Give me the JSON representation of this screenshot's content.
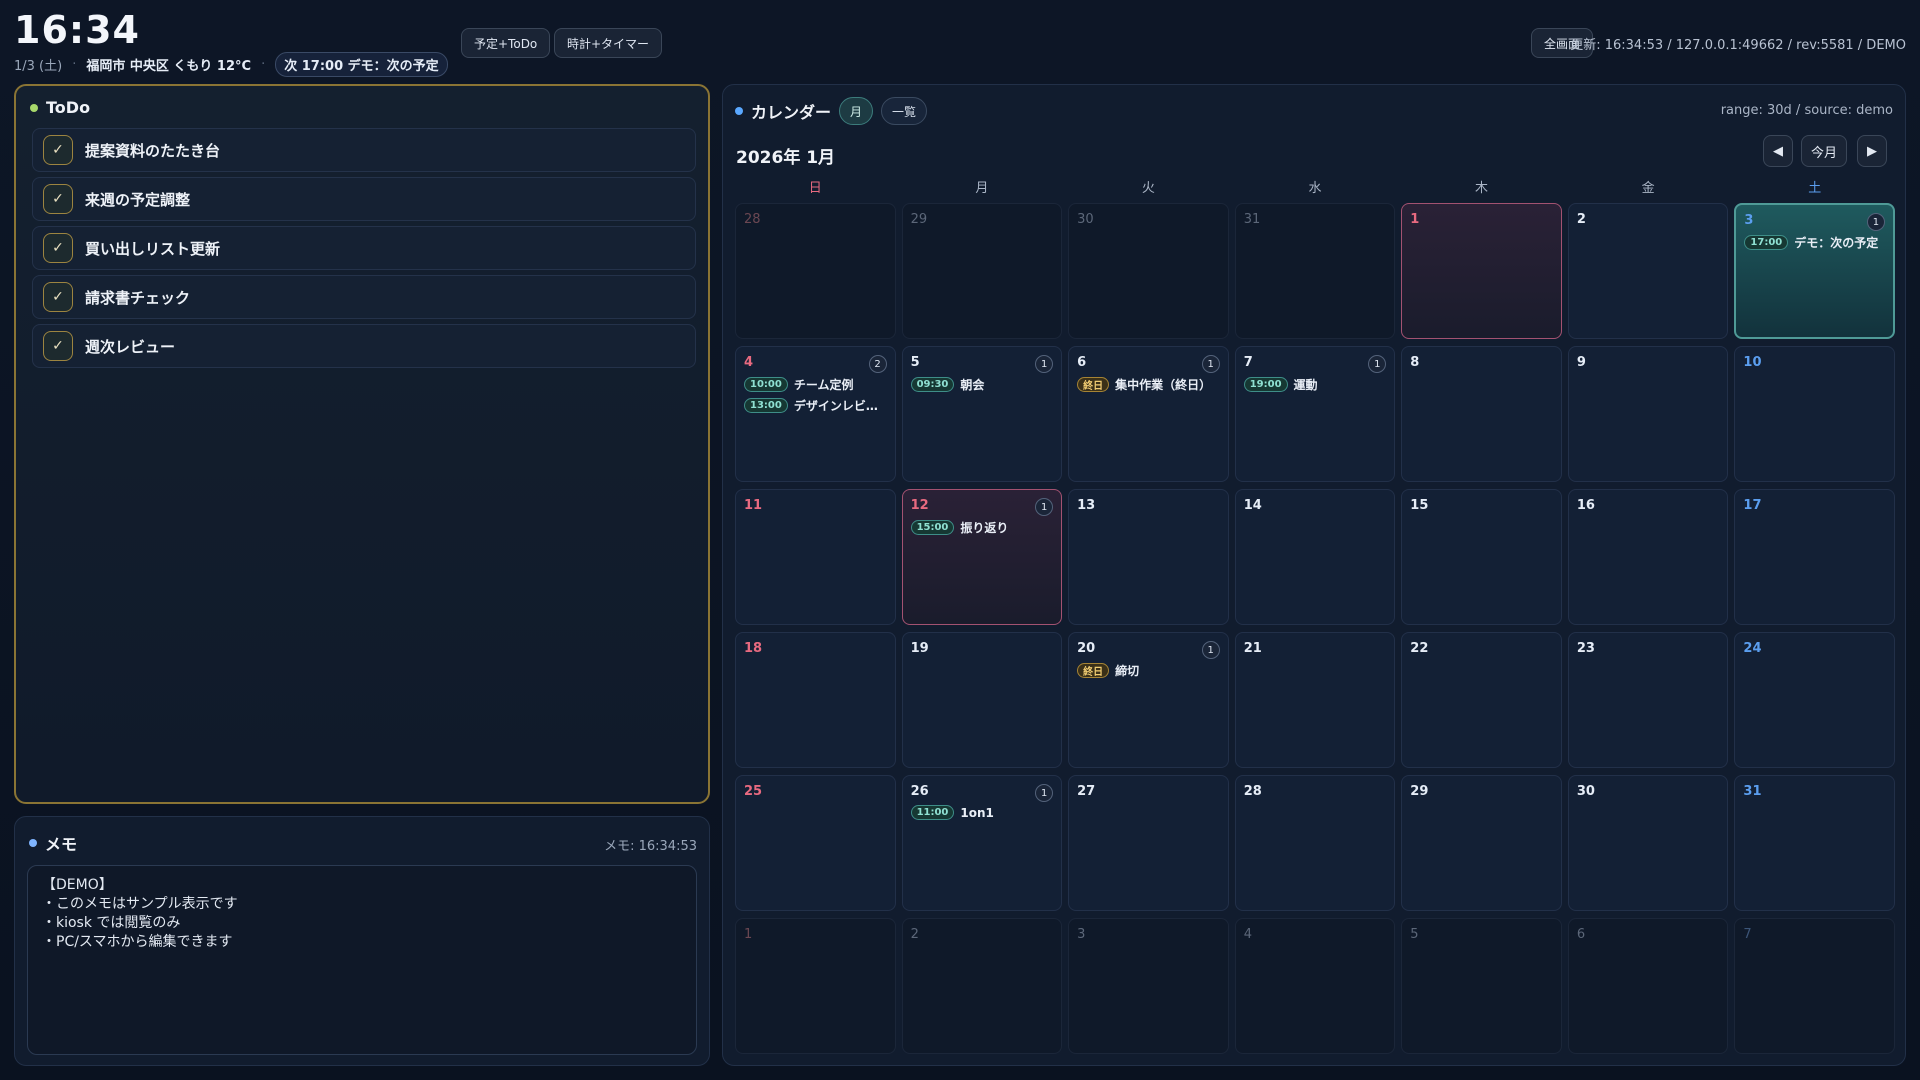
{
  "header": {
    "time": "16:34",
    "date": "1/3 (土)",
    "weather": "福岡市 中央区 くもり 12°C",
    "next": "次 17:00 デモ：次の予定",
    "btn_schedule": "予定+ToDo",
    "btn_clock": "時計+タイマー",
    "btn_fullscreen": "全画面",
    "status": "更新: 16:34:53 / 127.0.0.1:49662 / rev:5581 / DEMO"
  },
  "todo": {
    "title": "ToDo",
    "items": [
      {
        "label": "提案資料のたたき台"
      },
      {
        "label": "来週の予定調整"
      },
      {
        "label": "買い出しリスト更新"
      },
      {
        "label": "請求書チェック"
      },
      {
        "label": "週次レビュー"
      }
    ]
  },
  "memo": {
    "title": "メモ",
    "time": "メモ: 16:34:53",
    "lines": [
      "【DEMO】",
      "・このメモはサンプル表示です",
      "・kiosk では閲覧のみ",
      "・PC/スマホから編集できます"
    ]
  },
  "calendar": {
    "title": "カレンダー",
    "view_month": "月",
    "view_list": "一覧",
    "range": "range: 30d / source: demo",
    "month_label": "2026年 1月",
    "prev": "◀",
    "today": "今月",
    "next": "▶",
    "weekdays": [
      "日",
      "月",
      "火",
      "水",
      "木",
      "金",
      "土"
    ],
    "days": [
      {
        "n": "28",
        "other": true
      },
      {
        "n": "29",
        "other": true
      },
      {
        "n": "30",
        "other": true
      },
      {
        "n": "31",
        "other": true
      },
      {
        "n": "1",
        "holiday": true
      },
      {
        "n": "2"
      },
      {
        "n": "3",
        "today": true,
        "count": "1",
        "events": [
          {
            "time": "17:00",
            "title": "デモ：次の予定"
          }
        ]
      },
      {
        "n": "4",
        "count": "2",
        "events": [
          {
            "time": "10:00",
            "title": "チーム定例"
          },
          {
            "time": "13:00",
            "title": "デザインレビ…"
          }
        ]
      },
      {
        "n": "5",
        "count": "1",
        "events": [
          {
            "time": "09:30",
            "title": "朝会"
          }
        ]
      },
      {
        "n": "6",
        "count": "1",
        "events": [
          {
            "time": "終日",
            "allday": true,
            "title": "集中作業（終日）"
          }
        ]
      },
      {
        "n": "7",
        "count": "1",
        "events": [
          {
            "time": "19:00",
            "title": "運動"
          }
        ]
      },
      {
        "n": "8"
      },
      {
        "n": "9"
      },
      {
        "n": "10"
      },
      {
        "n": "11"
      },
      {
        "n": "12",
        "holiday": true,
        "count": "1",
        "events": [
          {
            "time": "15:00",
            "title": "振り返り"
          }
        ]
      },
      {
        "n": "13"
      },
      {
        "n": "14"
      },
      {
        "n": "15"
      },
      {
        "n": "16"
      },
      {
        "n": "17"
      },
      {
        "n": "18"
      },
      {
        "n": "19"
      },
      {
        "n": "20",
        "count": "1",
        "events": [
          {
            "time": "終日",
            "allday": true,
            "title": "締切"
          }
        ]
      },
      {
        "n": "21"
      },
      {
        "n": "22"
      },
      {
        "n": "23"
      },
      {
        "n": "24"
      },
      {
        "n": "25"
      },
      {
        "n": "26",
        "count": "1",
        "events": [
          {
            "time": "11:00",
            "title": "1on1"
          }
        ]
      },
      {
        "n": "27"
      },
      {
        "n": "28"
      },
      {
        "n": "29"
      },
      {
        "n": "30"
      },
      {
        "n": "31"
      },
      {
        "n": "1",
        "other": true
      },
      {
        "n": "2",
        "other": true
      },
      {
        "n": "3",
        "other": true
      },
      {
        "n": "4",
        "other": true
      },
      {
        "n": "5",
        "other": true
      },
      {
        "n": "6",
        "other": true
      },
      {
        "n": "7",
        "other": true
      }
    ]
  },
  "colors": {
    "todo_dot": "#a7d86b",
    "memo_dot": "#7fb4ff",
    "calendar_dot": "#5aa8ff",
    "sunday": "#e86a80",
    "saturday": "#5b9eef",
    "todo_border": "#8a7434"
  }
}
